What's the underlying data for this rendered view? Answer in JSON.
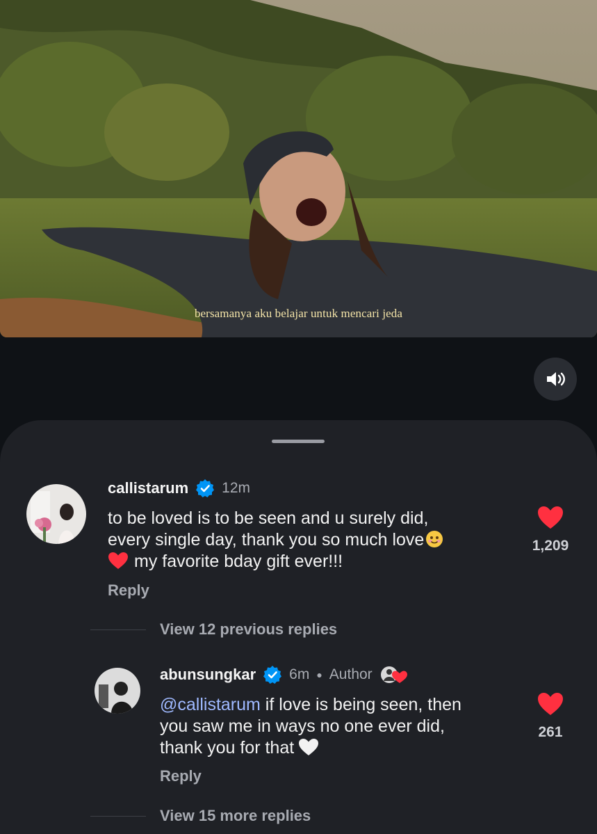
{
  "video": {
    "caption": "bersamanya aku belajar untuk mencari jeda"
  },
  "controls": {
    "sound_icon": "speaker-icon"
  },
  "comments": [
    {
      "username": "callistarum",
      "verified": true,
      "time": "12m",
      "text_lines": [
        "to be loved is to be seen and u surely did,",
        "every single day, thank you so much love",
        "my favorite bday gift ever!!!"
      ],
      "likes": "1,209",
      "reply_label": "Reply"
    },
    {
      "username": "abunsungkar",
      "verified": true,
      "time": "6m",
      "author_label": "Author",
      "mention": "@callistarum",
      "text_lines": [
        " if love is being seen, then",
        "you saw me in ways no one ever did,",
        "thank you for that"
      ],
      "likes": "261",
      "reply_label": "Reply"
    }
  ],
  "threads": {
    "previous_replies": "View 12 previous replies",
    "more_replies": "View 15 more replies"
  },
  "colors": {
    "like_red": "#ff3040",
    "verified_blue": "#0095f6",
    "sheet_bg": "#1f2126",
    "mention_blue": "#9fb9ff"
  }
}
